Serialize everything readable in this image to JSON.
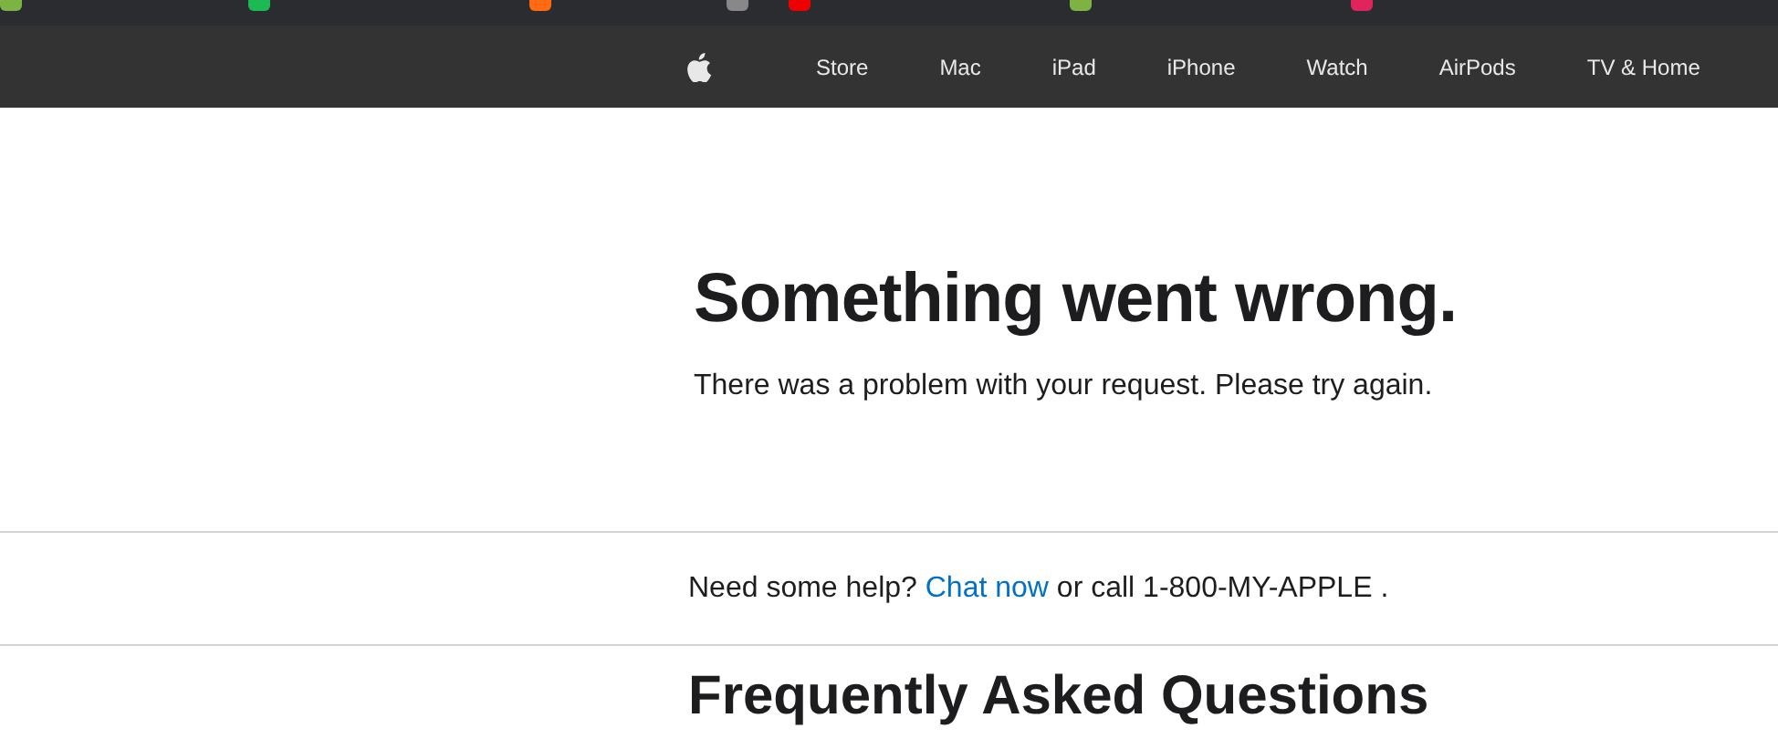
{
  "nav": {
    "items": [
      {
        "label": "Store"
      },
      {
        "label": "Mac"
      },
      {
        "label": "iPad"
      },
      {
        "label": "iPhone"
      },
      {
        "label": "Watch"
      },
      {
        "label": "AirPods"
      },
      {
        "label": "TV & Home"
      }
    ]
  },
  "error": {
    "title": "Something went wrong.",
    "message": "There was a problem with your request. Please try again."
  },
  "help": {
    "before": "Need some help?",
    "link": "Chat now",
    "after": "or call 1-800-MY-APPLE ."
  },
  "faq": {
    "title": "Frequently Asked Questions"
  }
}
